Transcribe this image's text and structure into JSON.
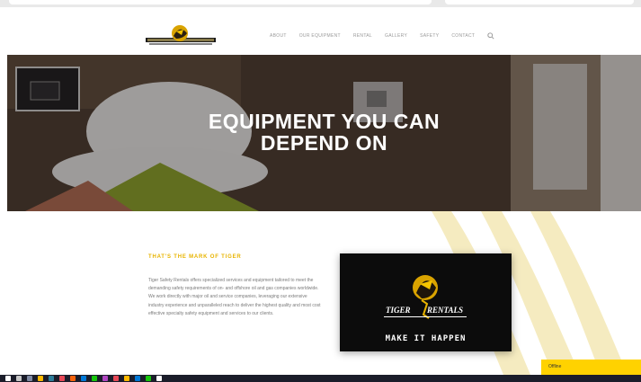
{
  "nav": {
    "items": [
      "About",
      "Our Equipment",
      "Rental",
      "Gallery",
      "Safety",
      "Contact"
    ]
  },
  "hero": {
    "title_line1": "EQUIPMENT YOU CAN",
    "title_line2": "DEPEND ON"
  },
  "about": {
    "subheading": "THAT'S THE MARK OF TIGER",
    "paragraph": "Tiger Safety Rentals offers specialized services and equipment tailored to meet the demanding safety requirements of on- and offshore oil and gas companies worldwide. We work directly with major oil and service companies, leveraging our extensive industry experience and unparalleled reach to deliver the highest quality and most cost effective specialty safety equipment and services to our clients."
  },
  "promo": {
    "tagline": "MAKE IT HAPPEN"
  },
  "chat": {
    "label": "Offline"
  },
  "colors": {
    "accent": "#e8b400",
    "chat": "#ffd200",
    "promo_bg": "#0c0c0c"
  },
  "icons": [
    "search-icon",
    "tiger-logo",
    "claw-mark",
    "tiger-emblem"
  ]
}
